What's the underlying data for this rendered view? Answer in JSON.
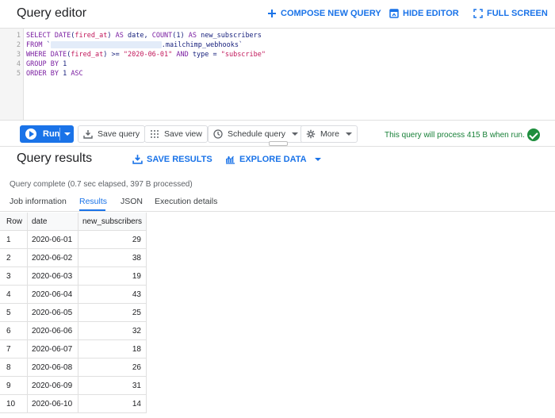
{
  "header": {
    "title": "Query editor",
    "compose_label": "COMPOSE NEW QUERY",
    "hide_editor_label": "HIDE EDITOR",
    "full_screen_label": "FULL SCREEN"
  },
  "editor": {
    "lines": [
      {
        "num": "1",
        "parts": [
          [
            "kw",
            "SELECT DATE"
          ],
          [
            "plain",
            "("
          ],
          [
            "str",
            "fired_at"
          ],
          [
            "plain",
            ") "
          ],
          [
            "kw",
            "AS"
          ],
          [
            "plain",
            " date, "
          ],
          [
            "kw",
            "COUNT"
          ],
          [
            "plain",
            "(1) "
          ],
          [
            "kw",
            "AS"
          ],
          [
            "plain",
            " new_subscribers"
          ]
        ]
      },
      {
        "num": "2",
        "parts": [
          [
            "kw",
            "FROM"
          ],
          [
            "plain",
            " `"
          ],
          [
            "redact",
            ""
          ],
          [
            "plain",
            ".mailchimp_webhooks`"
          ]
        ]
      },
      {
        "num": "3",
        "parts": [
          [
            "kw",
            "WHERE DATE"
          ],
          [
            "plain",
            "("
          ],
          [
            "str",
            "fired_at"
          ],
          [
            "plain",
            ") >= "
          ],
          [
            "str",
            "\"2020-06-01\""
          ],
          [
            "plain",
            " "
          ],
          [
            "kw",
            "AND"
          ],
          [
            "plain",
            " type = "
          ],
          [
            "str",
            "\"subscribe\""
          ]
        ]
      },
      {
        "num": "4",
        "parts": [
          [
            "kw",
            "GROUP BY"
          ],
          [
            "plain",
            " 1"
          ]
        ]
      },
      {
        "num": "5",
        "parts": [
          [
            "kw",
            "ORDER BY"
          ],
          [
            "plain",
            " 1 "
          ],
          [
            "kw",
            "ASC"
          ]
        ]
      }
    ]
  },
  "toolbar": {
    "run_label": "Run",
    "save_query_label": "Save query",
    "save_view_label": "Save view",
    "schedule_label": "Schedule query",
    "more_label": "More",
    "process_message": "This query will process 415 B when run."
  },
  "results": {
    "title": "Query results",
    "save_results_label": "SAVE RESULTS",
    "explore_label": "EXPLORE DATA",
    "status": "Query complete (0.7 sec elapsed, 397 B processed)",
    "tabs": [
      "Job information",
      "Results",
      "JSON",
      "Execution details"
    ],
    "active_tab": "Results",
    "columns": [
      "Row",
      "date",
      "new_subscribers"
    ],
    "rows": [
      [
        "1",
        "2020-06-01",
        "29"
      ],
      [
        "2",
        "2020-06-02",
        "38"
      ],
      [
        "3",
        "2020-06-03",
        "19"
      ],
      [
        "4",
        "2020-06-04",
        "43"
      ],
      [
        "5",
        "2020-06-05",
        "25"
      ],
      [
        "6",
        "2020-06-06",
        "32"
      ],
      [
        "7",
        "2020-06-07",
        "18"
      ],
      [
        "8",
        "2020-06-08",
        "26"
      ],
      [
        "9",
        "2020-06-09",
        "31"
      ],
      [
        "10",
        "2020-06-10",
        "14"
      ]
    ]
  },
  "colors": {
    "accent": "#1a73e8",
    "success": "#188038",
    "keyword": "#7b1fa2",
    "string": "#c2185b"
  },
  "icons": [
    "plus-icon",
    "hide-editor-icon",
    "full-screen-icon",
    "play-icon",
    "save-icon",
    "save-view-icon",
    "clock-icon",
    "gear-icon",
    "check-icon",
    "download-icon",
    "explore-chart-icon"
  ]
}
